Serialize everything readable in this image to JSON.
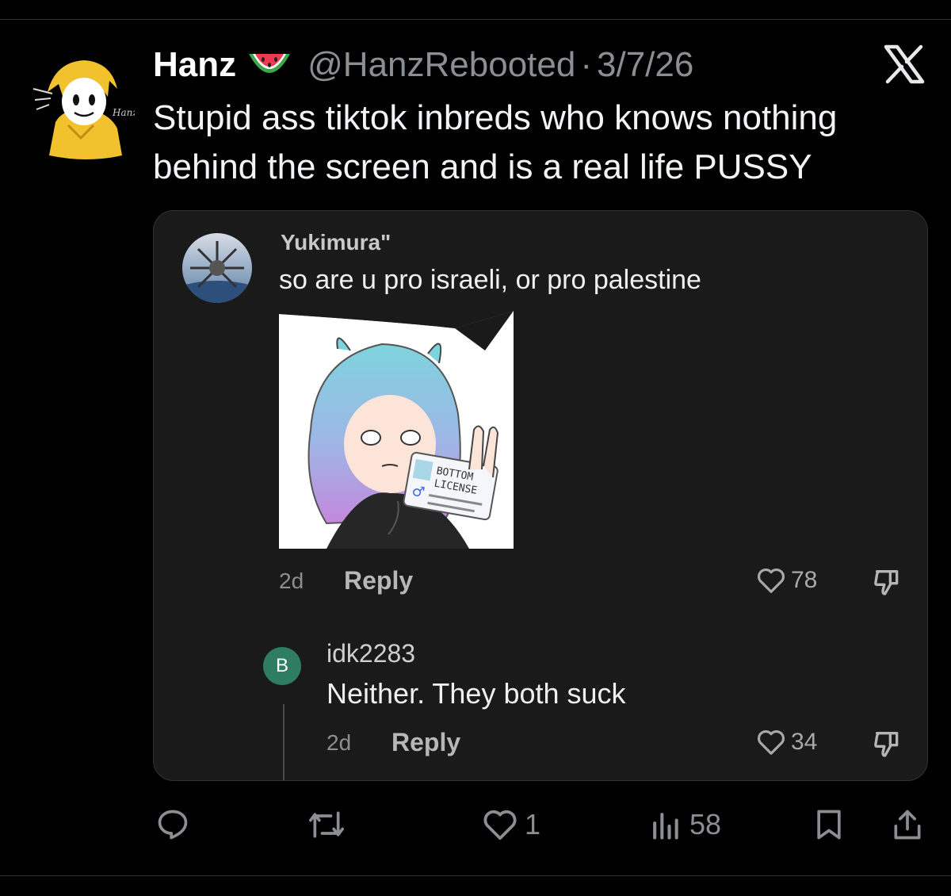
{
  "tweet": {
    "display_name": "Hanz",
    "name_emoji": "watermelon-emoji",
    "handle": "@HanzRebooted",
    "separator": "·",
    "date": "3/7/26",
    "text": "Stupid ass tiktok inbreds who knows nothing behind the screen and is a real life PUSSY",
    "avatar_signature": "Hanz"
  },
  "quoted": {
    "comment": {
      "username": "Yukimura\"",
      "text": "so are u pro israeli, or pro palestine",
      "sticker_text": [
        "BOTTOM",
        "LICENSE"
      ],
      "sticker_symbol": "♂",
      "age": "2d",
      "reply_label": "Reply",
      "likes": "78"
    },
    "reply": {
      "avatar_letter": "B",
      "username": "idk2283",
      "text": "Neither. They both suck",
      "age": "2d",
      "reply_label": "Reply",
      "likes": "34"
    }
  },
  "actions": {
    "likes": "1",
    "views": "58"
  },
  "colors": {
    "background": "#000000",
    "card": "#1a1a1a",
    "muted": "#8b8f94",
    "reply_avatar": "#2e7d63"
  }
}
